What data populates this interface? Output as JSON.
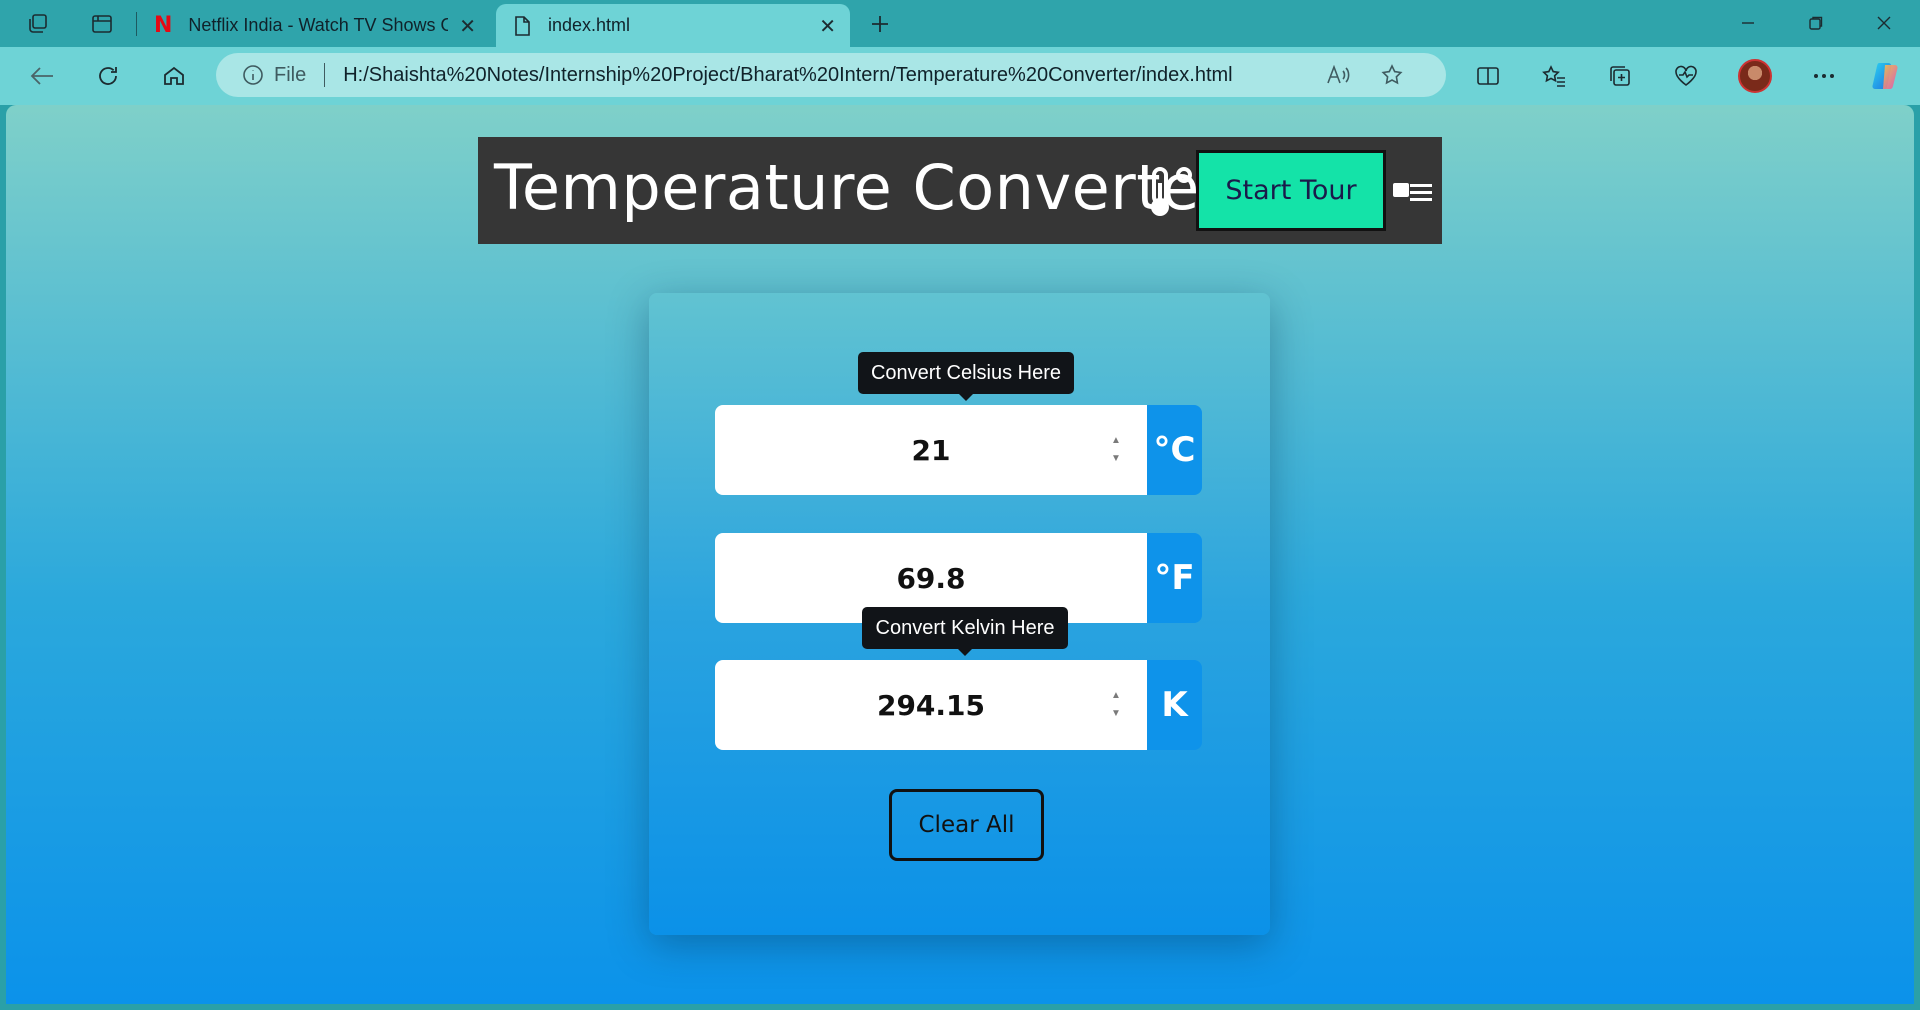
{
  "browser": {
    "tabs": [
      {
        "title": "Netflix India - Watch TV Shows O",
        "active": false
      },
      {
        "title": "index.html",
        "active": true
      }
    ],
    "address": {
      "scheme_label": "File",
      "url": "H:/Shaishta%20Notes/Internship%20Project/Bharat%20Intern/Temperature%20Converter/index.html"
    }
  },
  "page": {
    "title": "Temperature Converter",
    "start_tour_label": "Start Tour",
    "fields": [
      {
        "value": "21",
        "unit": "°C",
        "tooltip": "Convert Celsius Here"
      },
      {
        "value": "69.8",
        "unit": "°F"
      },
      {
        "value": "294.15",
        "unit": "K",
        "tooltip": "Convert Kelvin Here"
      }
    ],
    "clear_label": "Clear All"
  },
  "colors": {
    "header_bg": "#363636",
    "start_tour_bg": "#14e3a8",
    "unit_bg": "#0e93ea",
    "tab_active": "#6ed3d6",
    "tabbar": "#2fa4ab"
  }
}
